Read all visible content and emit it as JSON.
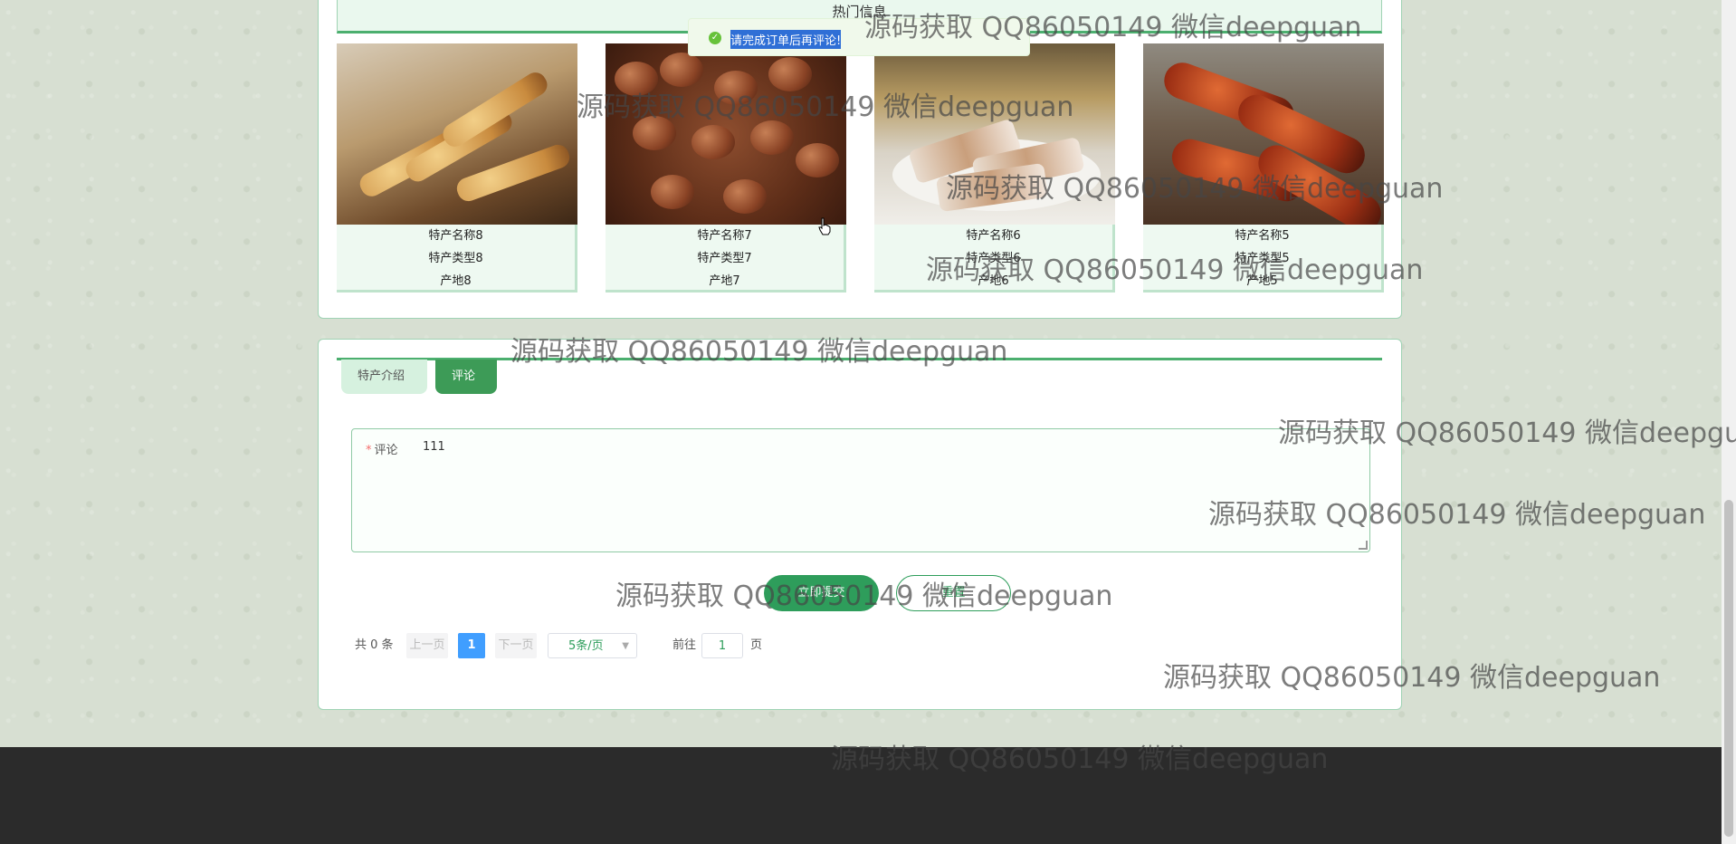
{
  "hot": {
    "title": "热门信息",
    "products": [
      {
        "name": "特产名称8",
        "type": "特产类型8",
        "origin": "产地8"
      },
      {
        "name": "特产名称7",
        "type": "特产类型7",
        "origin": "产地7"
      },
      {
        "name": "特产名称6",
        "type": "特产类型6",
        "origin": "产地6"
      },
      {
        "name": "特产名称5",
        "type": "特产类型5",
        "origin": "产地5"
      }
    ]
  },
  "toast": {
    "message": "请完成订单后再评论!"
  },
  "tabs": {
    "intro": "特产介绍",
    "comment": "评论"
  },
  "comment_form": {
    "required_mark": "*",
    "label": "评论",
    "value": "111",
    "submit_label": "立即提交",
    "reset_label": "重置"
  },
  "pagination": {
    "total": "共 0 条",
    "prev": "上一页",
    "current": "1",
    "next": "下一页",
    "page_size": "5条/页",
    "goto_prefix": "前往",
    "goto_value": "1",
    "goto_suffix": "页"
  },
  "watermark": "源码获取 QQ86050149 微信deepguan",
  "colors": {
    "accent": "#2e9d5b",
    "tab_active": "#3d9b57",
    "page_active": "#409eff",
    "toast_bg": "#f0f9eb",
    "footer": "#2b2b2b"
  }
}
